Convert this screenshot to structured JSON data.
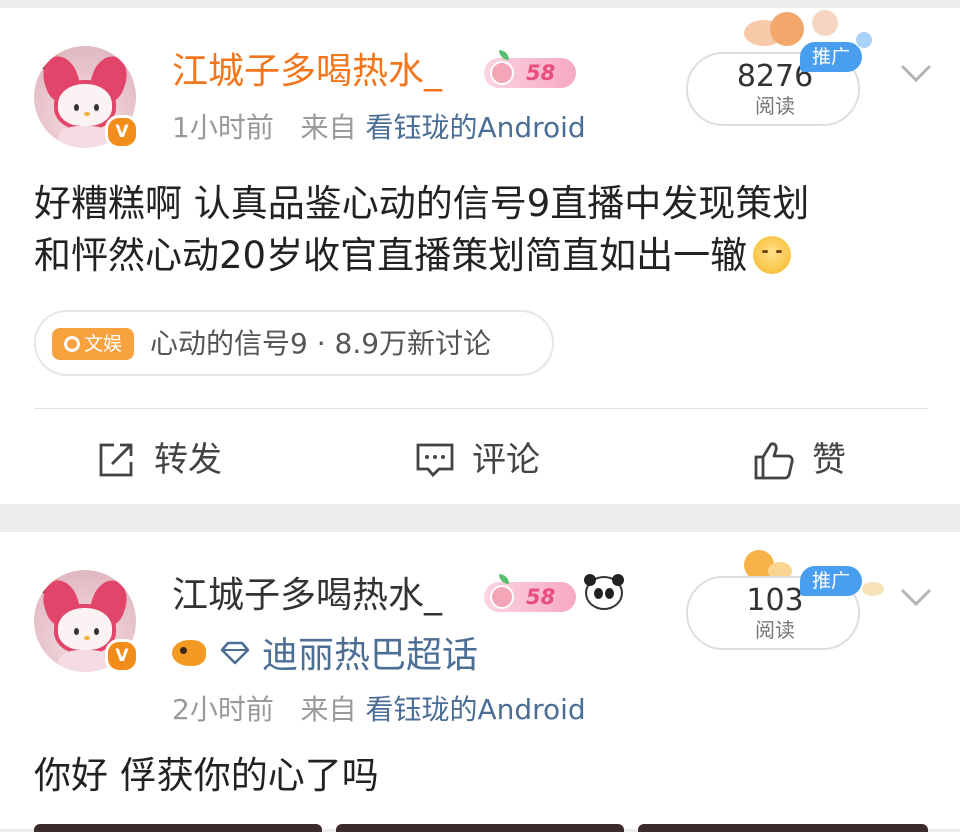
{
  "posts": [
    {
      "username": "江城子多喝热水_",
      "level": "58",
      "time": "1小时前",
      "from_prefix": "来自",
      "source": "看钰珑的Android",
      "read_count": "8276",
      "read_label": "阅读",
      "promo_label": "推广",
      "content_line1": "好糟糕啊 认真品鉴心动的信号9直播中发现策划",
      "content_line2": "和怦然心动20岁收官直播策划简直如出一辙",
      "topic_tag": "文娱",
      "topic_text": "心动的信号9 · 8.9万新讨论"
    },
    {
      "username": "江城子多喝热水_",
      "level": "58",
      "super_topic": "迪丽热巴超话",
      "time": "2小时前",
      "from_prefix": "来自",
      "source": "看钰珑的Android",
      "read_count": "103",
      "read_label": "阅读",
      "promo_label": "推广",
      "content_line1": "你好 俘获你的心了吗"
    }
  ],
  "actions": {
    "repost": "转发",
    "comment": "评论",
    "like": "赞"
  },
  "colors": {
    "username_vip": "#f2761c",
    "link_blue": "#4c6e95",
    "promo_blue": "#4a9ef0",
    "verified_orange": "#f28c1b",
    "topic_tag_orange": "#f7a23e"
  },
  "icons": {
    "verified": "v-badge-icon",
    "repost": "repost-icon",
    "comment": "comment-icon",
    "like": "thumbs-up-icon",
    "more": "chevron-down-icon"
  }
}
